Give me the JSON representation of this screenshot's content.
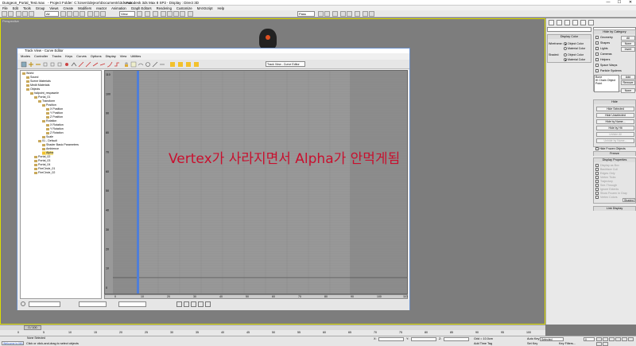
{
  "titlebar": {
    "filename": "Dungeon_Portal_Test.max",
    "project": "- Project Folder: C:\\Users\\dejeon\\Documents\\3dsmax",
    "app": "- Autodesk 3ds Max 8 SP2",
    "display": "- Display : Direct 3D",
    "min": "—",
    "max": "☐",
    "close": "✕"
  },
  "menubar": [
    "File",
    "Edit",
    "Tools",
    "Group",
    "Views",
    "Create",
    "Modifiers",
    "reactor",
    "Animation",
    "Graph Editors",
    "Rendering",
    "Customize",
    "MAXScript",
    "Help"
  ],
  "toolbar": {
    "selection_filter": "All",
    "ref_coord": "View",
    "named_selection": "Pass"
  },
  "viewport": {
    "label": "Perspective"
  },
  "cmdpanel": {
    "hide_by_category": "Hide by Category",
    "categories": [
      "Geometry",
      "Shapes",
      "Lights",
      "Cameras",
      "Helpers",
      "Space Warps",
      "Particle Systems",
      "Bone Objects"
    ],
    "btn_all": "All",
    "btn_none": "None",
    "btn_invert": "Invert",
    "display_color": "Display Color",
    "wireframe": "Wireframe:",
    "shaded": "Shaded:",
    "object_color": "Object Color",
    "material_color": "Material Color",
    "list_items": [
      "Bone",
      "IK Chain Object",
      "Point"
    ],
    "btn_add": "Add",
    "btn_remove": "Remove",
    "btn_none2": "None",
    "hide_title": "Hide",
    "hide_buttons": [
      "Hide Selected",
      "Hide Unselected",
      "Hide by Name...",
      "Hide by Hit",
      "Unhide All",
      "Unhide by Name..."
    ],
    "hide_frozen": "Hide Frozen Objects",
    "freeze_title": "Freeze",
    "display_props_title": "Display Properties",
    "display_props": [
      "Display as Box",
      "Backface Cull",
      "Edges Only",
      "Vertex Ticks",
      "Trajectory",
      "See-Through",
      "Ignore Extents",
      "Show Frozen in Gray",
      "Vertex Colors"
    ],
    "shaded_btn": "Shaded",
    "link_display": "Link Display"
  },
  "trackview": {
    "title": "Track View - Curve Editor",
    "menu": [
      "Modes",
      "Controller",
      "Tracks",
      "Keys",
      "Curves",
      "Options",
      "Display",
      "View",
      "Utilities"
    ],
    "name_field": "Track View - Curve Editor",
    "tree": [
      {
        "label": "World",
        "indent": 0
      },
      {
        "label": "Sound",
        "indent": 1
      },
      {
        "label": "Scene Materials",
        "indent": 1
      },
      {
        "label": "Medit Materials",
        "indent": 1
      },
      {
        "label": "Objects",
        "indent": 1
      },
      {
        "label": "halpoint_respawnle",
        "indent": 2
      },
      {
        "label": "Portal_01",
        "indent": 3
      },
      {
        "label": "Transform",
        "indent": 4
      },
      {
        "label": "Position",
        "indent": 5
      },
      {
        "label": "X Position",
        "indent": 6
      },
      {
        "label": "Y Position",
        "indent": 6
      },
      {
        "label": "Z Position",
        "indent": 6
      },
      {
        "label": "Rotation",
        "indent": 5
      },
      {
        "label": "X Rotation",
        "indent": 6
      },
      {
        "label": "Y Rotation",
        "indent": 6
      },
      {
        "label": "Z Rotation",
        "indent": 6
      },
      {
        "label": "Scale",
        "indent": 5
      },
      {
        "label": "01 - Default",
        "indent": 4
      },
      {
        "label": "Shader Basic Parameters",
        "indent": 5
      },
      {
        "label": "Ambience",
        "indent": 5
      },
      {
        "label": "Alpha",
        "indent": 5
      },
      {
        "label": "Portal_02",
        "indent": 3
      },
      {
        "label": "Portal_03",
        "indent": 3
      },
      {
        "label": "Portal_04",
        "indent": 3
      },
      {
        "label": "FireCircle_01",
        "indent": 3
      },
      {
        "label": "FireCircle_02",
        "indent": 3
      }
    ],
    "y_labels": [
      "110",
      "100",
      "90",
      "80",
      "70",
      "60",
      "50",
      "40",
      "30",
      "20",
      "10",
      "0"
    ],
    "x_labels": [
      "0",
      "10",
      "20",
      "30",
      "40",
      "50",
      "60",
      "70",
      "80",
      "90",
      "100",
      "110"
    ],
    "annotation": "Vertex가 사라지면서 Alpha가 안먹게됨"
  },
  "timeline": {
    "slider_label": "0 / 100",
    "ticks": [
      "0",
      "5",
      "10",
      "15",
      "20",
      "25",
      "30",
      "35",
      "40",
      "45",
      "50",
      "55",
      "60",
      "65",
      "70",
      "75",
      "80",
      "85",
      "90",
      "95",
      "100"
    ]
  },
  "status": {
    "none_selected": "None Selected",
    "prompt": "Click or click-and-drag to select objects",
    "maxscript": "Welcome to MAX",
    "x_label": "X:",
    "y_label": "Y:",
    "z_label": "Z:",
    "grid": "Grid = 10.0cm",
    "add_time_tag": "Add Time Tag",
    "auto_key": "Auto Key",
    "set_key": "Set Key",
    "selected": "Selected",
    "key_filters": "Key Filters...",
    "frame": "0"
  }
}
